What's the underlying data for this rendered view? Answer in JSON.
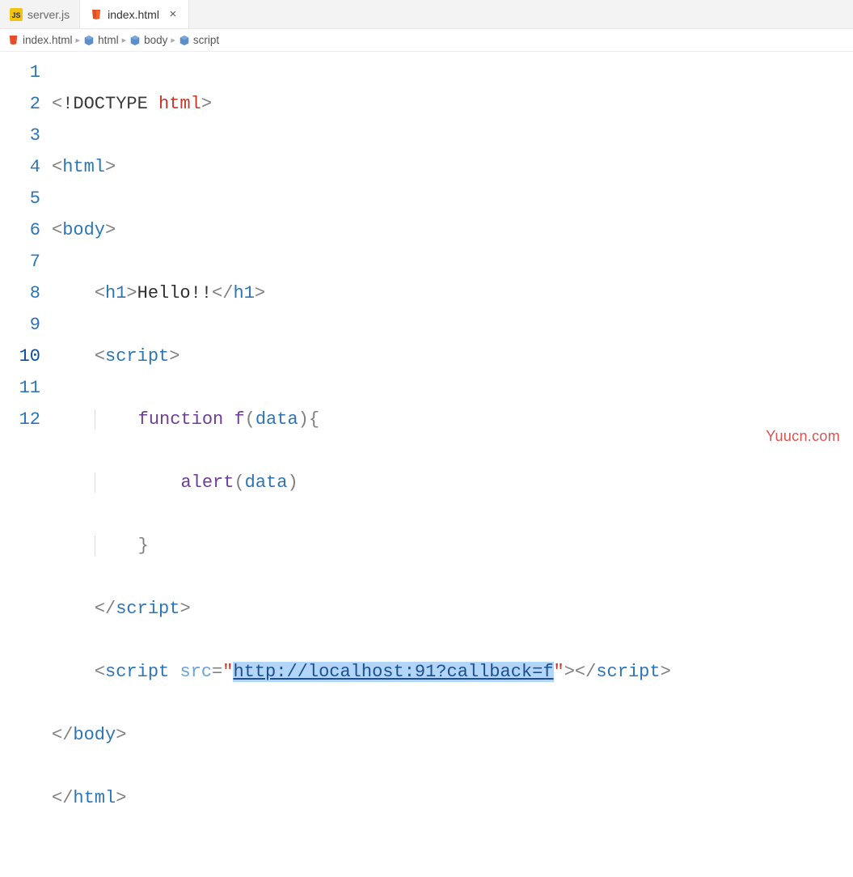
{
  "tabs": [
    {
      "icon": "js",
      "label": "server.js",
      "active": false,
      "close": false
    },
    {
      "icon": "html",
      "label": "index.html",
      "active": true,
      "close": true
    }
  ],
  "breadcrumbs": [
    {
      "icon": "html-file",
      "label": "index.html"
    },
    {
      "icon": "cube",
      "label": "html"
    },
    {
      "icon": "cube",
      "label": "body"
    },
    {
      "icon": "cube",
      "label": "script"
    }
  ],
  "line_numbers": [
    "1",
    "2",
    "3",
    "4",
    "5",
    "6",
    "7",
    "8",
    "9",
    "10",
    "11",
    "12"
  ],
  "active_line": 10,
  "code": {
    "l1": {
      "doctype": "!DOCTYPE",
      "kw": "html"
    },
    "l2": {
      "tag": "html"
    },
    "l3": {
      "tag": "body"
    },
    "l4": {
      "tag": "h1",
      "text": "Hello!!"
    },
    "l5": {
      "tag": "script"
    },
    "l6": {
      "kw": "function",
      "name": "f",
      "param": "data"
    },
    "l7": {
      "fn": "alert",
      "arg": "data"
    },
    "l8": {
      "brace": "}"
    },
    "l9": {
      "closetag": "script"
    },
    "l10": {
      "tag": "script",
      "attr": "src",
      "val": "http://localhost:91?callback=f",
      "closetag": "script"
    },
    "l11": {
      "closetag": "body"
    },
    "l12": {
      "closetag": "html"
    }
  },
  "watermark": "Yuucn.com"
}
